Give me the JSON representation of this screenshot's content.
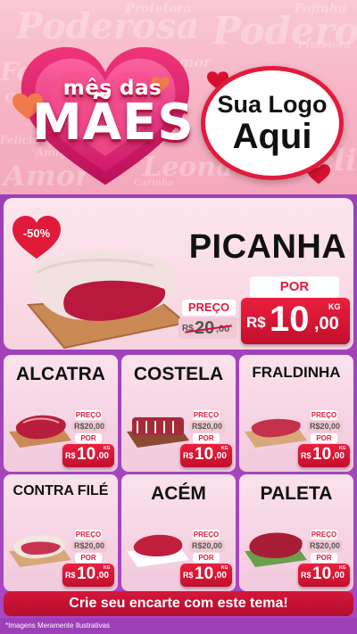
{
  "header": {
    "background_words": [
      "Poderosa",
      "Poderosa",
      "Protetora",
      "Fofinha",
      "Feliz",
      "Amor",
      "Carinho",
      "Amor",
      "Felicidade",
      "Amiga",
      "Leona",
      "Feliz",
      "Protetora",
      "Carinho"
    ],
    "maes_top": "mês das",
    "maes_main": "MÃES",
    "logo_line1": "Sua Logo",
    "logo_line2": "Aqui"
  },
  "hero": {
    "discount": "-50%",
    "name": "PICANHA",
    "preco_label": "PREÇO",
    "old_price_prefix": "R$",
    "old_price_int": "20",
    "old_price_dec": ",00",
    "por_label": "POR",
    "new_price_prefix": "R$",
    "new_price_int": "10",
    "new_price_dec": ",00",
    "unit": "KG"
  },
  "products": [
    {
      "name": "ALCATRA",
      "preco_label": "PREÇO",
      "old_price": "R$20,00",
      "por_label": "POR",
      "prefix": "R$",
      "price_int": "10",
      "price_dec": ",00",
      "unit": "KG"
    },
    {
      "name": "COSTELA",
      "preco_label": "PREÇO",
      "old_price": "R$20,00",
      "por_label": "POR",
      "prefix": "R$",
      "price_int": "10",
      "price_dec": ",00",
      "unit": "KG"
    },
    {
      "name": "FRALDINHA",
      "preco_label": "PREÇO",
      "old_price": "R$20,00",
      "por_label": "POR",
      "prefix": "R$",
      "price_int": "10",
      "price_dec": ",00",
      "unit": "KG"
    },
    {
      "name": "CONTRA FILÉ",
      "preco_label": "PREÇO",
      "old_price": "R$20,00",
      "por_label": "POR",
      "prefix": "R$",
      "price_int": "10",
      "price_dec": ",00",
      "unit": "KG"
    },
    {
      "name": "ACÉM",
      "preco_label": "PREÇO",
      "old_price": "R$20,00",
      "por_label": "POR",
      "prefix": "R$",
      "price_int": "10",
      "price_dec": ",00",
      "unit": "KG"
    },
    {
      "name": "PALETA",
      "preco_label": "PREÇO",
      "old_price": "R$20,00",
      "por_label": "POR",
      "prefix": "R$",
      "price_int": "10",
      "price_dec": ",00",
      "unit": "KG"
    }
  ],
  "footer": {
    "cta": "Crie seu encarte com este tema!",
    "disclaimer": "*Imagens Meramente Ilustrativas"
  },
  "colors": {
    "accent_red": "#e21b3c",
    "panel_purple": "#9d3fb7",
    "card_pink": "#fbe2ec",
    "header_pink": "#f6b2c4"
  }
}
